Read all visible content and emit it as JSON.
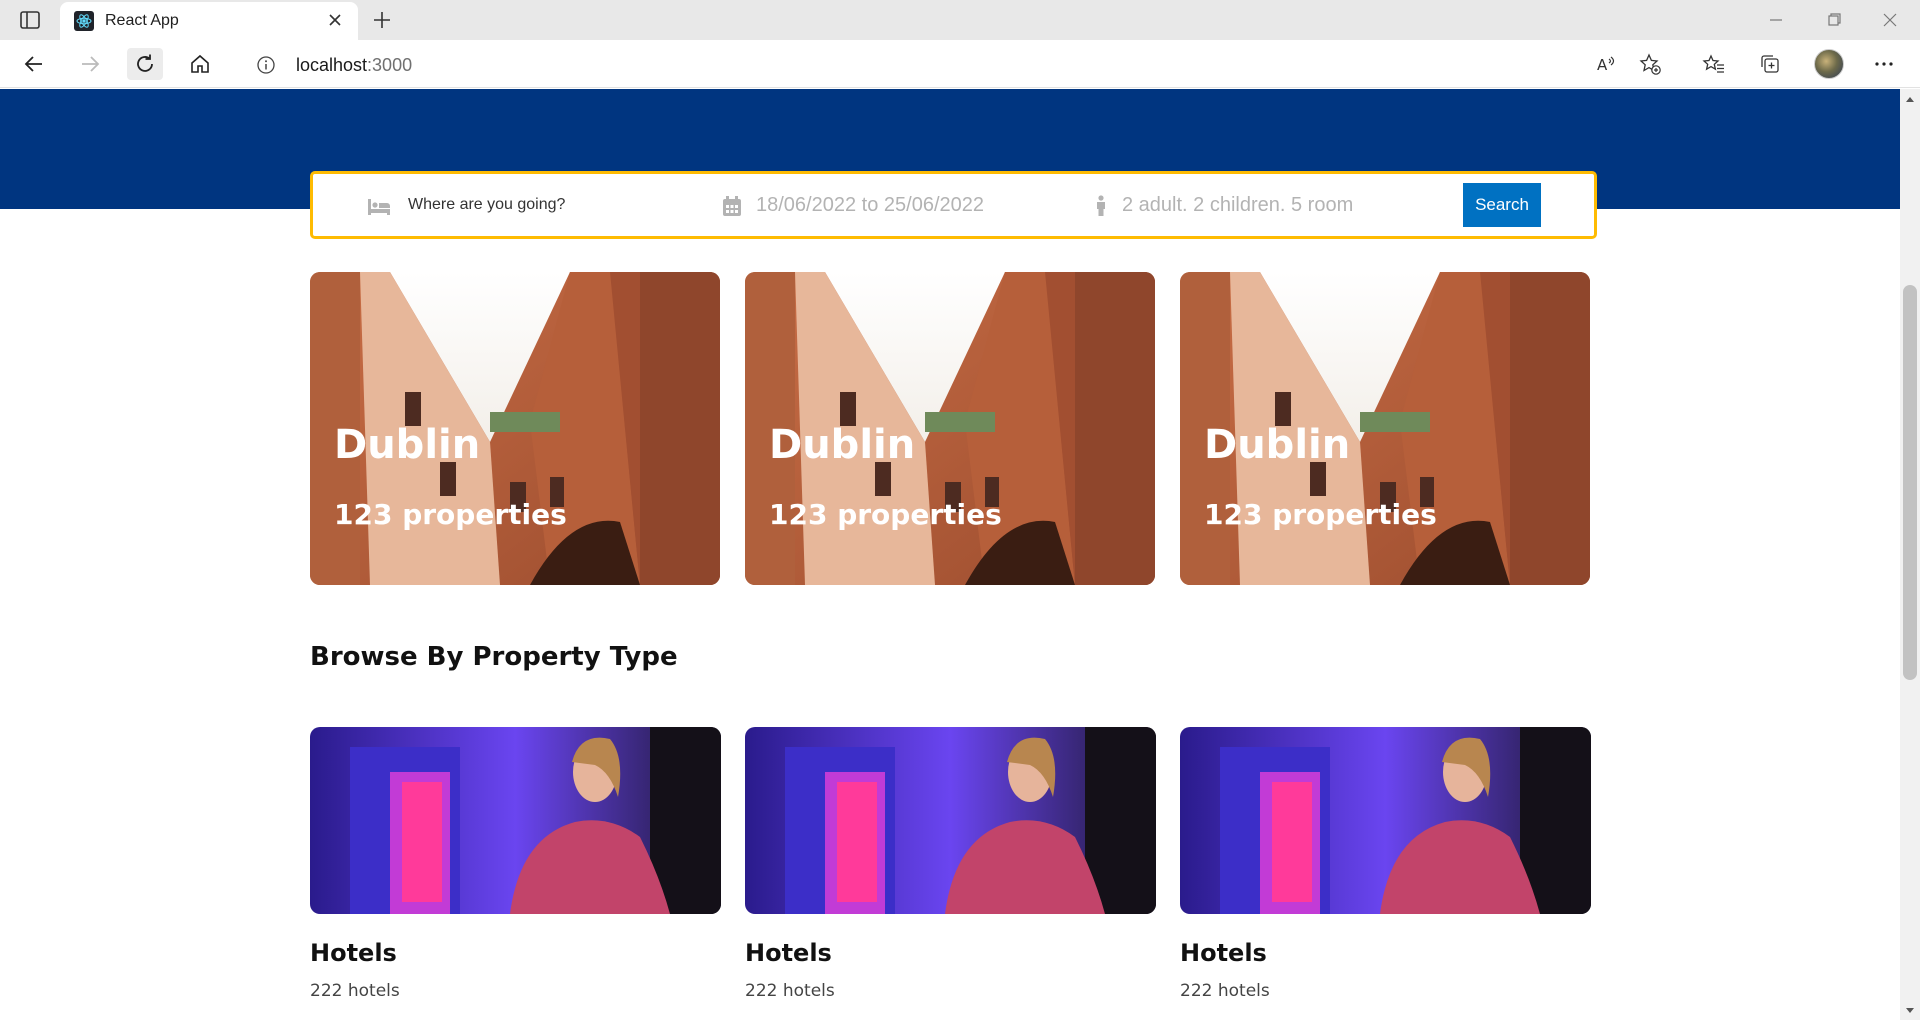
{
  "browser": {
    "tab_title": "React App",
    "address_host": "localhost",
    "address_port": ":3000"
  },
  "search": {
    "destination_placeholder": "Where are you going?",
    "dates": "18/06/2022 to 25/06/2022",
    "guests": "2 adult. 2 children. 5 room",
    "button_label": "Search"
  },
  "featured": [
    {
      "title": "Dublin",
      "subtitle": "123 properties"
    },
    {
      "title": "Dublin",
      "subtitle": "123 properties"
    },
    {
      "title": "Dublin",
      "subtitle": "123 properties"
    }
  ],
  "property_section": {
    "title": "Browse By Property Type",
    "items": [
      {
        "title": "Hotels",
        "count": "222 hotels"
      },
      {
        "title": "Hotels",
        "count": "222 hotels"
      },
      {
        "title": "Hotels",
        "count": "222 hotels"
      }
    ]
  },
  "colors": {
    "header_blue": "#003580",
    "search_border": "#febb02",
    "search_button": "#0071c2"
  },
  "icons": [
    "sidebar-icon",
    "react-icon",
    "close-icon",
    "plus-icon",
    "back-icon",
    "forward-icon",
    "refresh-icon",
    "home-icon",
    "info-icon",
    "read-aloud-icon",
    "add-favorite-icon",
    "favorites-icon",
    "collections-icon",
    "more-icon",
    "bed-icon",
    "calendar-icon",
    "person-icon"
  ]
}
